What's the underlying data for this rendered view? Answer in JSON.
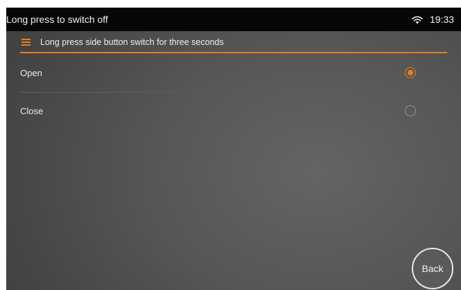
{
  "status_bar": {
    "title": "Long press to switch off",
    "time": "19:33",
    "icons": [
      "wifi-icon"
    ]
  },
  "section": {
    "icon": "menu-icon",
    "title": "Long press side button switch for three seconds"
  },
  "options": [
    {
      "label": "Open",
      "selected": true
    },
    {
      "label": "Close",
      "selected": false
    }
  ],
  "back_button": {
    "label": "Back"
  },
  "colors": {
    "accent": "#ec7d1e",
    "status_bar": "#070707",
    "text": "#f2f2f2",
    "radio_unchecked": "#959595"
  }
}
